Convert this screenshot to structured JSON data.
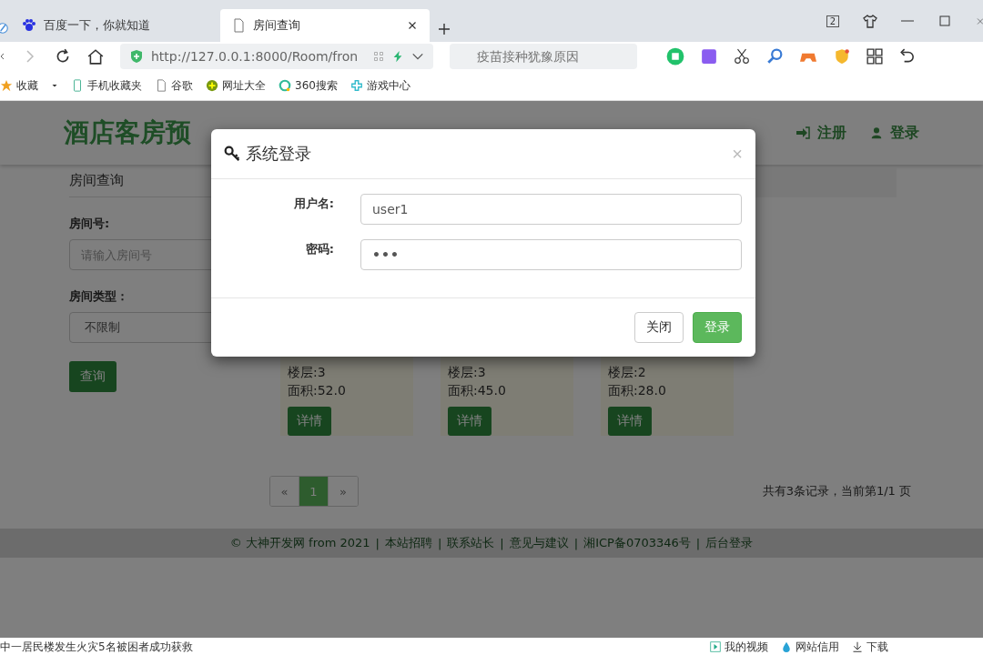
{
  "browser": {
    "tabs": [
      {
        "title": "百度一下，你就知道",
        "selected": false
      },
      {
        "title": "房间查询",
        "selected": true
      }
    ],
    "window_badge": "2",
    "url": "http://127.0.0.1:8000/Room/fron",
    "search": {
      "placeholder": "疫苗接种犹豫原因"
    },
    "bookmarks": [
      "收藏",
      "手机收藏夹",
      "谷歌",
      "网址大全",
      "360搜索",
      "游戏中心"
    ]
  },
  "site": {
    "logo": "酒店客房预",
    "auth_links": [
      "注册",
      "登录"
    ]
  },
  "sidebar": {
    "title": "房间查询",
    "room_no_label": "房间号:",
    "room_no": {
      "placeholder": "请输入房间号"
    },
    "type_label": "房间类型：",
    "type_value": "不限制",
    "search_button": "查询"
  },
  "rooms": [
    {
      "lines": [
        "楼层:3",
        "面积:52.0"
      ],
      "button": "详情"
    },
    {
      "lines": [
        "楼层:3",
        "面积:45.0"
      ],
      "button": "详情"
    },
    {
      "lines": [
        "楼层:2",
        "面积:28.0"
      ],
      "button": "详情"
    }
  ],
  "pagination": {
    "prev": "«",
    "pages": [
      {
        "label": "1",
        "selected": true
      }
    ],
    "next": "»",
    "summary": "共有3条记录，当前第1/1 页"
  },
  "footer": {
    "copyright": "© 大神开发网 from 2021",
    "separator": "|",
    "links": [
      "本站招聘",
      "联系站长",
      "意见与建议",
      "湘ICP备0703346号",
      "后台登录"
    ]
  },
  "modal": {
    "title": "系统登录",
    "close": "×",
    "fields": [
      {
        "label": "用户名:",
        "value": "user1",
        "kind": "text"
      },
      {
        "label": "密码:",
        "value": "•••",
        "kind": "password"
      }
    ],
    "buttons": [
      {
        "label": "关闭",
        "kind": "default"
      },
      {
        "label": "登录",
        "kind": "primary"
      }
    ]
  },
  "status_bar": {
    "news": "中一居民楼发生火灾5名被困者成功获救",
    "items": [
      "我的视频",
      "网站信用",
      "下载"
    ]
  }
}
